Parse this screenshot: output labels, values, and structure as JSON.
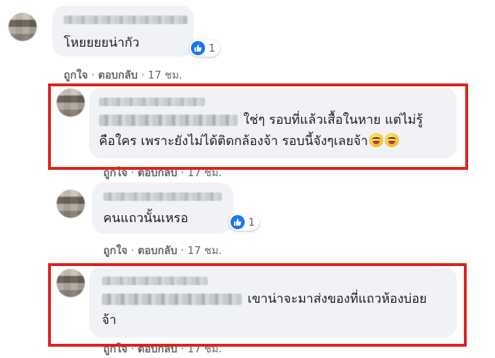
{
  "comments": [
    {
      "text": "โหยยยยน่ากัว",
      "reaction_count": "1",
      "actions": {
        "like": "ถูกใจ",
        "sep": "·",
        "reply": "ตอบกลับ",
        "time": "17 ชม."
      }
    },
    {
      "text_line1": "ใช่ๆ รอบที่แล้วเสื้อในหาย แต่ไม่รู้",
      "text_line2": "คือใคร เพราะยังไม่ได้ติดกล้องจ้า รอบนี้จังๆเลยจ้า",
      "actions": {
        "like": "ถูกใจ",
        "sep": "·",
        "reply": "ตอบกลับ",
        "time": "17 ชม."
      }
    },
    {
      "text": "คนแถวนั้นเหรอ",
      "reaction_count": "1",
      "actions": {
        "like": "ถูกใจ",
        "sep": "·",
        "reply": "ตอบกลับ",
        "time": "17 ชม."
      }
    },
    {
      "text_line1": "เขาน่าจะมาส่งของที่แถวห้องบ่อย",
      "text_line2": "จ้า",
      "actions": {
        "like": "ถูกใจ",
        "sep": "·",
        "reply": "ตอบกลับ",
        "time": "17 ชม."
      }
    }
  ],
  "colors": {
    "highlight_box": "#e0201b",
    "bubble": "#f0f2f5",
    "like_blue": "#1877f2"
  },
  "icons": {
    "reaction": "like-thumb-icon",
    "emoji": "grinning-tongue-emoji-icon"
  }
}
